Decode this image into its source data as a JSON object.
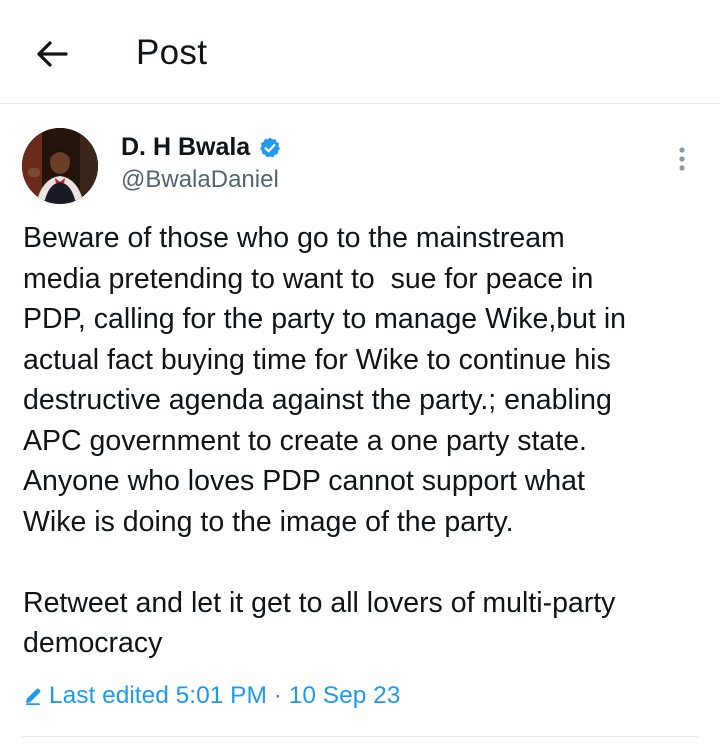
{
  "header": {
    "title": "Post",
    "back_icon": "arrow-left-icon"
  },
  "post": {
    "author": {
      "name": "D. H Bwala",
      "handle": "@BwalaDaniel",
      "verified": true
    },
    "text": "Beware of those who go to the mainstream\nmedia pretending to want to  sue for peace in\nPDP, calling for the party to manage Wike,but in\nactual fact buying time for Wike to continue his\ndestructive agenda against the party.; enabling\nAPC government to create a one party state.\nAnyone who loves PDP cannot support what\nWike is doing to the image of the party.\n\nRetweet and let it get to all lovers of multi-party\ndemocracy",
    "edited_label": "Last edited 5:01 PM · 10 Sep 23"
  },
  "colors": {
    "accent": "#1d9bf0",
    "text_primary": "#0f1419",
    "text_secondary": "#536471",
    "divider": "#e6e9ec"
  }
}
